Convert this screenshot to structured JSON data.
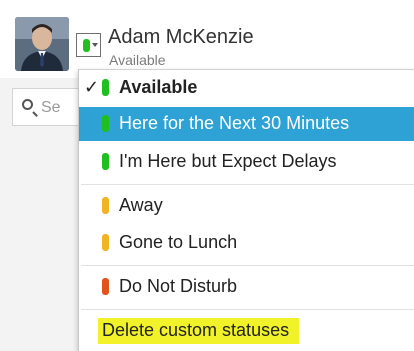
{
  "user": {
    "name": "Adam McKenzie",
    "status": "Available"
  },
  "search": {
    "placeholder": "Se"
  },
  "menu": {
    "items": [
      {
        "label": "Available",
        "color": "#1fbf1f",
        "checked": true,
        "bold": true,
        "selected": false
      },
      {
        "label": "Here for the Next 30 Minutes",
        "color": "#1fbf1f",
        "checked": false,
        "bold": false,
        "selected": true
      },
      {
        "label": "I'm Here but Expect Delays",
        "color": "#1fbf1f",
        "checked": false,
        "bold": false,
        "selected": false
      },
      {
        "label": "Away",
        "color": "#f1b323",
        "checked": false,
        "bold": false,
        "selected": false
      },
      {
        "label": "Gone to Lunch",
        "color": "#f1b323",
        "checked": false,
        "bold": false,
        "selected": false
      },
      {
        "label": "Do Not Disturb",
        "color": "#e2531c",
        "checked": false,
        "bold": false,
        "selected": false
      }
    ],
    "footer_label": "Delete custom statuses"
  },
  "colors": {
    "selected_bg": "#2fa2d5",
    "highlight": "#f2f22a",
    "available": "#1fbf1f",
    "away": "#f1b323",
    "dnd": "#e2531c"
  }
}
